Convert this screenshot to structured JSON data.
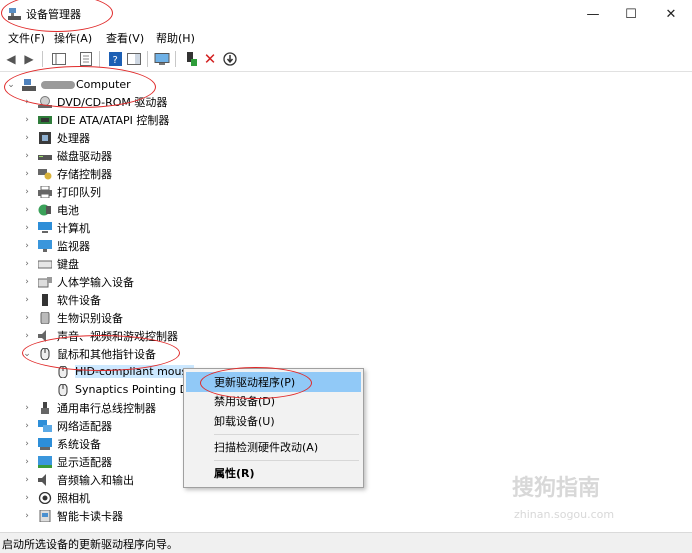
{
  "window": {
    "title": "设备管理器",
    "controls": [
      "—",
      "☐",
      "✕"
    ]
  },
  "menu": [
    "文件(F)",
    "操作(A)",
    "查看(V)",
    "帮助(H)"
  ],
  "tree": {
    "root": "Computer",
    "categories": [
      {
        "label": "DVD/CD-ROM 驱动器",
        "icon": "dvd-drive-icon"
      },
      {
        "label": "IDE ATA/ATAPI 控制器",
        "icon": "ide-controller-icon"
      },
      {
        "label": "处理器",
        "icon": "processor-icon"
      },
      {
        "label": "磁盘驱动器",
        "icon": "disk-drive-icon"
      },
      {
        "label": "存储控制器",
        "icon": "storage-controller-icon"
      },
      {
        "label": "打印队列",
        "icon": "printer-icon"
      },
      {
        "label": "电池",
        "icon": "battery-icon"
      },
      {
        "label": "计算机",
        "icon": "computer-icon"
      },
      {
        "label": "监视器",
        "icon": "monitor-icon"
      },
      {
        "label": "键盘",
        "icon": "keyboard-icon"
      },
      {
        "label": "人体学输入设备",
        "icon": "hid-icon"
      },
      {
        "label": "软件设备",
        "icon": "software-device-icon"
      },
      {
        "label": "生物识别设备",
        "icon": "biometric-icon"
      },
      {
        "label": "声音、视频和游戏控制器",
        "icon": "sound-icon"
      },
      {
        "label": "鼠标和其他指针设备",
        "icon": "mouse-icon",
        "expanded": true,
        "children": [
          "HID-compliant mouse",
          "Synaptics Pointing De"
        ]
      },
      {
        "label": "通用串行总线控制器",
        "icon": "usb-icon"
      },
      {
        "label": "网络适配器",
        "icon": "network-adapter-icon"
      },
      {
        "label": "系统设备",
        "icon": "system-device-icon"
      },
      {
        "label": "显示适配器",
        "icon": "display-adapter-icon"
      },
      {
        "label": "音频输入和输出",
        "icon": "audio-io-icon"
      },
      {
        "label": "照相机",
        "icon": "camera-icon"
      },
      {
        "label": "智能卡读卡器",
        "icon": "smartcard-reader-icon"
      }
    ]
  },
  "context_menu": {
    "items": [
      "更新驱动程序(P)",
      "禁用设备(D)",
      "卸载设备(U)",
      "扫描检测硬件改动(A)",
      "属性(R)"
    ]
  },
  "status": "启动所选设备的更新驱动程序向导。",
  "watermark": {
    "brand": "搜狗指南",
    "url": "zhinan.sogou.com"
  },
  "colors": {
    "selection": "#cce8ff",
    "menu_highlight": "#91c9f7",
    "annotation": "#e02a2a"
  }
}
